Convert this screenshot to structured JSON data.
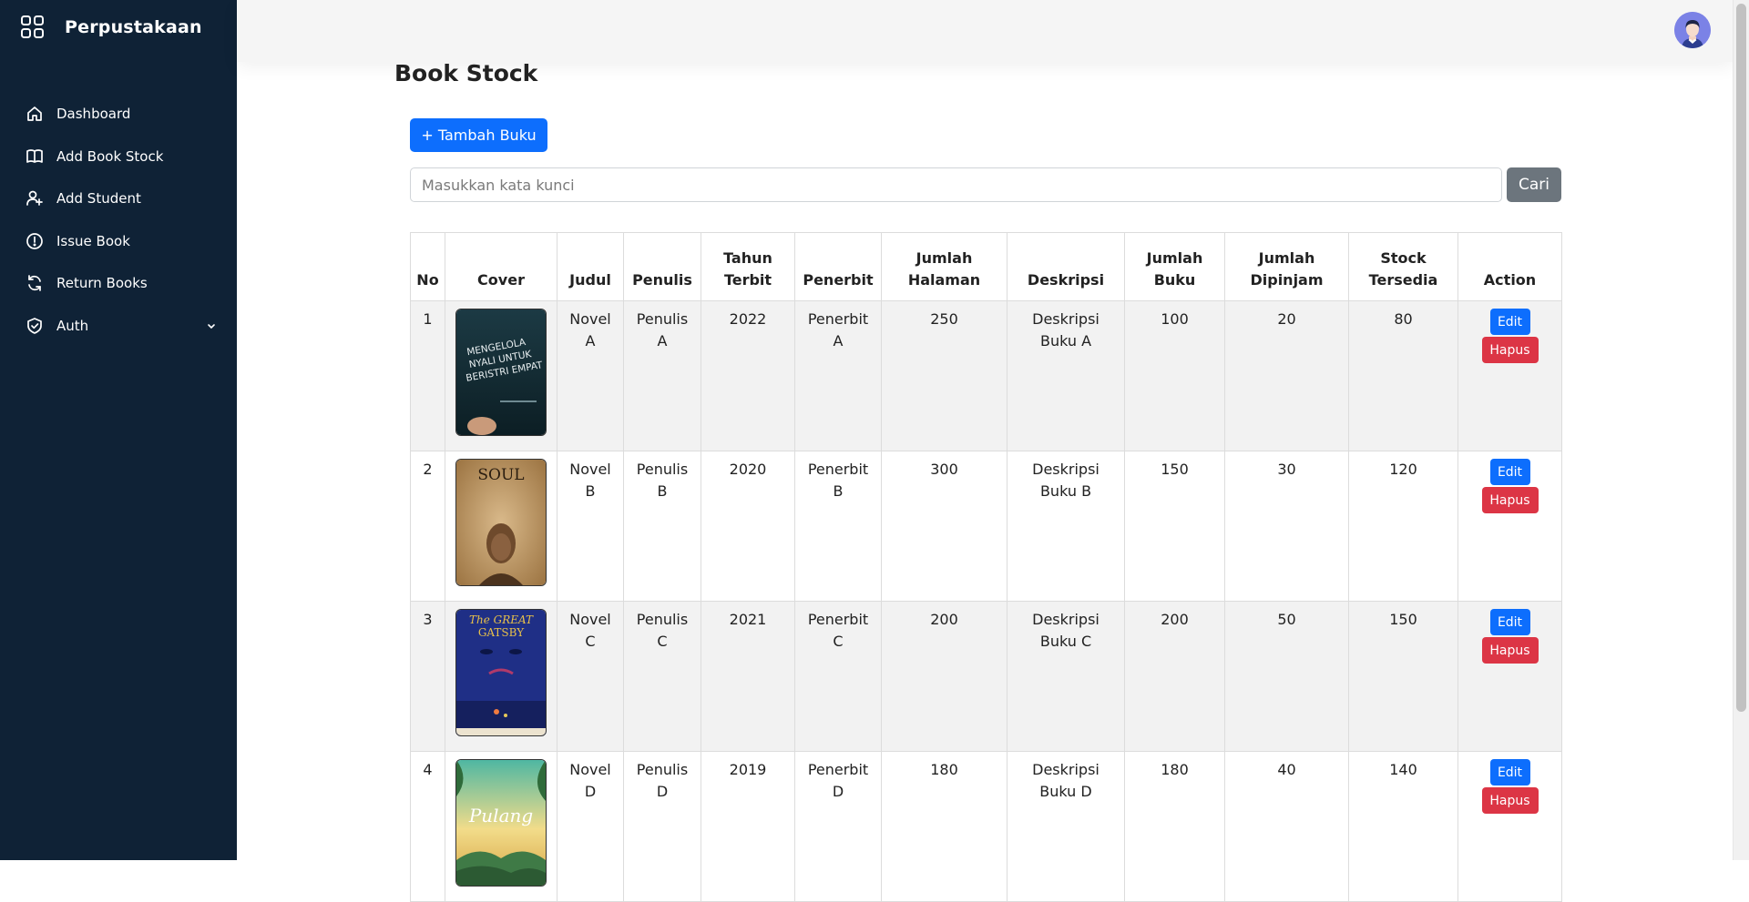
{
  "sidebar": {
    "brand": "Perpustakaan",
    "items": [
      {
        "label": "Dashboard",
        "icon": "home-icon"
      },
      {
        "label": "Add Book Stock",
        "icon": "book-icon"
      },
      {
        "label": "Add Student",
        "icon": "user-plus-icon"
      },
      {
        "label": "Issue Book",
        "icon": "alert-circle-icon"
      },
      {
        "label": "Return Books",
        "icon": "refresh-icon"
      },
      {
        "label": "Auth",
        "icon": "shield-check-icon"
      }
    ]
  },
  "page": {
    "title": "Book Stock",
    "add_button": "+ Tambah Buku",
    "search_placeholder": "Masukkan kata kunci",
    "search_button": "Cari"
  },
  "table": {
    "headers": [
      "No",
      "Cover",
      "Judul",
      "Penulis",
      "Tahun Terbit",
      "Penerbit",
      "Jumlah Halaman",
      "Deskripsi",
      "Jumlah Buku",
      "Jumlah Dipinjam",
      "Stock Tersedia",
      "Action"
    ],
    "edit_label": "Edit",
    "delete_label": "Hapus",
    "rows": [
      {
        "no": "1",
        "cover_text": "MENGELOLA NYALI UNTUK BERISTRI EMPAT",
        "judul": "Novel A",
        "penulis": "Penulis A",
        "tahun": "2022",
        "penerbit": "Penerbit A",
        "halaman": "250",
        "deskripsi": "Deskripsi Buku A",
        "jumlah": "100",
        "dipinjam": "20",
        "tersedia": "80"
      },
      {
        "no": "2",
        "cover_text": "SOUL",
        "judul": "Novel B",
        "penulis": "Penulis B",
        "tahun": "2020",
        "penerbit": "Penerbit B",
        "halaman": "300",
        "deskripsi": "Deskripsi Buku B",
        "jumlah": "150",
        "dipinjam": "30",
        "tersedia": "120"
      },
      {
        "no": "3",
        "cover_text": "The GREAT GATSBY",
        "judul": "Novel C",
        "penulis": "Penulis C",
        "tahun": "2021",
        "penerbit": "Penerbit C",
        "halaman": "200",
        "deskripsi": "Deskripsi Buku C",
        "jumlah": "200",
        "dipinjam": "50",
        "tersedia": "150"
      },
      {
        "no": "4",
        "cover_text": "Pulang",
        "judul": "Novel D",
        "penulis": "Penulis D",
        "tahun": "2019",
        "penerbit": "Penerbit D",
        "halaman": "180",
        "deskripsi": "Deskripsi Buku D",
        "jumlah": "180",
        "dipinjam": "40",
        "tersedia": "140"
      }
    ]
  },
  "colors": {
    "sidebar_bg": "#0f2236",
    "primary": "#0d6efd",
    "danger": "#dc3545",
    "secondary": "#6c757d",
    "avatar": "#7b82e6"
  }
}
